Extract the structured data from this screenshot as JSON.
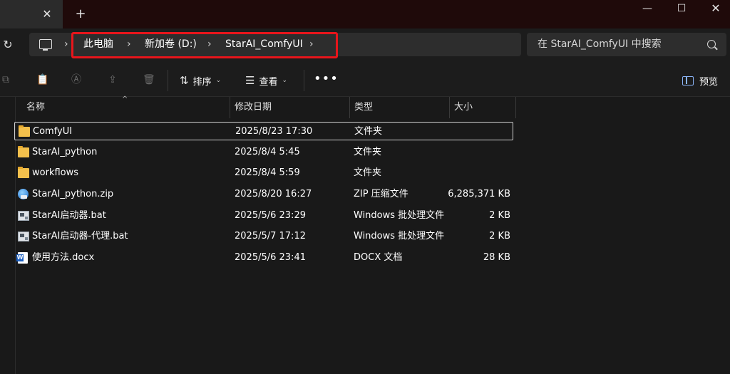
{
  "titlebar": {
    "tab_close": "✕",
    "new_tab": "+",
    "minimize": "—",
    "maximize": "☐",
    "close": "✕"
  },
  "address": {
    "refresh": "↻",
    "crumbs": [
      "此电脑",
      "新加卷 (D:)",
      "StarAI_ComfyUI"
    ],
    "separator": "›"
  },
  "search": {
    "placeholder": "在 StarAI_ComfyUI 中搜索"
  },
  "toolbar": {
    "sort_label": "排序",
    "view_label": "查看",
    "more": "•••",
    "preview_label": "预览"
  },
  "columns": {
    "name": "名称",
    "date": "修改日期",
    "type": "类型",
    "size": "大小"
  },
  "files": [
    {
      "name": "ComfyUI",
      "date": "2025/8/23 17:30",
      "type": "文件夹",
      "size": "",
      "icon": "folder-icon"
    },
    {
      "name": "StarAI_python",
      "date": "2025/8/4 5:45",
      "type": "文件夹",
      "size": "",
      "icon": "folder-icon"
    },
    {
      "name": "workflows",
      "date": "2025/8/4 5:59",
      "type": "文件夹",
      "size": "",
      "icon": "folder-icon"
    },
    {
      "name": "StarAI_python.zip",
      "date": "2025/8/20 16:27",
      "type": "ZIP 压缩文件",
      "size": "6,285,371 KB",
      "icon": "zip-icon"
    },
    {
      "name": "StarAI启动器.bat",
      "date": "2025/5/6 23:29",
      "type": "Windows 批处理文件",
      "size": "2 KB",
      "icon": "bat-icon"
    },
    {
      "name": "StarAI启动器-代理.bat",
      "date": "2025/5/7 17:12",
      "type": "Windows 批处理文件",
      "size": "2 KB",
      "icon": "bat-icon"
    },
    {
      "name": "使用方法.docx",
      "date": "2025/5/6 23:41",
      "type": "DOCX 文档",
      "size": "28 KB",
      "icon": "doc-icon"
    }
  ],
  "colors": {
    "highlight": "#e8151b",
    "background": "#191919",
    "titlebar": "#1f0a0a"
  }
}
